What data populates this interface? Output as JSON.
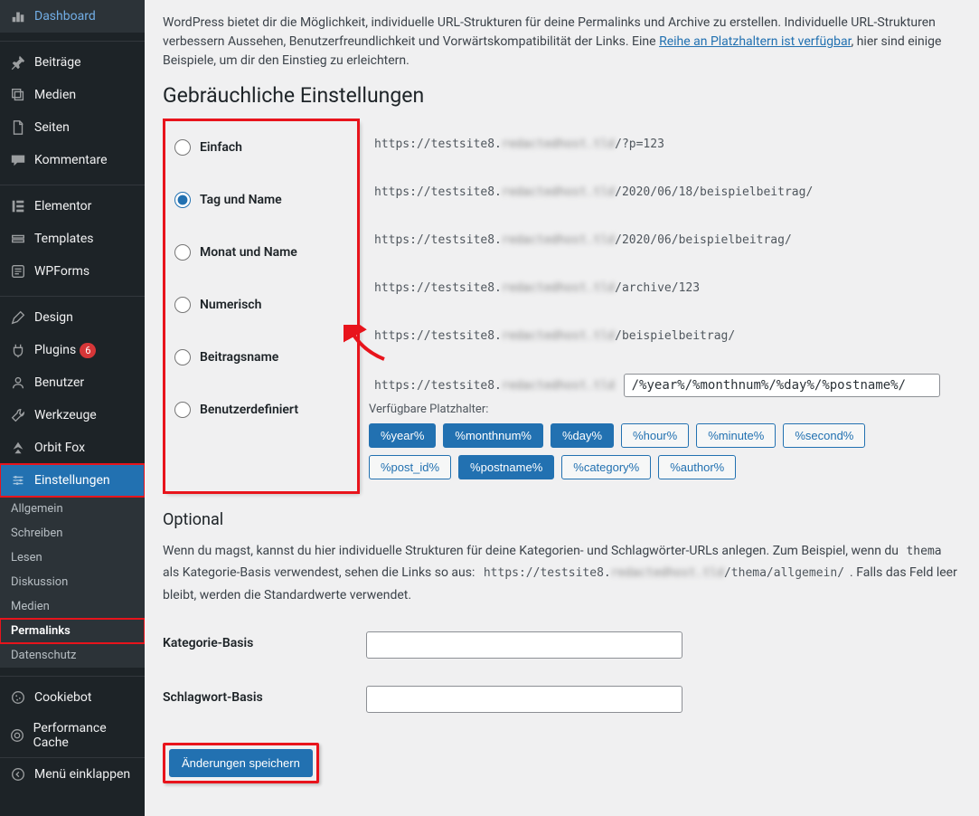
{
  "sidebar": {
    "dashboard": "Dashboard",
    "posts": "Beiträge",
    "media": "Medien",
    "pages": "Seiten",
    "comments": "Kommentare",
    "elementor": "Elementor",
    "templates": "Templates",
    "wpforms": "WPForms",
    "design": "Design",
    "plugins": "Plugins",
    "plugins_badge": "6",
    "users": "Benutzer",
    "tools": "Werkzeuge",
    "orbitfox": "Orbit Fox",
    "settings": "Einstellungen",
    "settings_sub": {
      "general": "Allgemein",
      "writing": "Schreiben",
      "reading": "Lesen",
      "discussion": "Diskussion",
      "media": "Medien",
      "permalinks": "Permalinks",
      "privacy": "Datenschutz"
    },
    "cookiebot": "Cookiebot",
    "perfcache": "Performance Cache",
    "collapse": "Menü einklappen"
  },
  "content": {
    "intro_1": "WordPress bietet dir die Möglichkeit, individuelle URL-Strukturen für deine Permalinks und Archive zu erstellen. Individuelle URL-Strukturen verbessern Aussehen, Benutzerfreundlichkeit und Vorwärtskompatibilität der Links. Eine ",
    "intro_link": "Reihe an Platzhaltern ist verfügbar",
    "intro_2": ", hier sind einige Beispiele, um dir den Einstieg zu erleichtern.",
    "common_heading": "Gebräuchliche Einstellungen",
    "options": {
      "plain": {
        "label": "Einfach",
        "url_prefix": "https://testsite8.",
        "url_suffix": "/?p=123"
      },
      "dayname": {
        "label": "Tag und Name",
        "url_prefix": "https://testsite8.",
        "url_suffix": "/2020/06/18/beispielbeitrag/"
      },
      "monthname": {
        "label": "Monat und Name",
        "url_prefix": "https://testsite8.",
        "url_suffix": "/2020/06/beispielbeitrag/"
      },
      "numeric": {
        "label": "Numerisch",
        "url_prefix": "https://testsite8.",
        "url_suffix": "/archive/123"
      },
      "postname": {
        "label": "Beitragsname",
        "url_prefix": "https://testsite8.",
        "url_suffix": "/beispielbeitrag/"
      },
      "custom": {
        "label": "Benutzerdefiniert",
        "url_prefix": "https://testsite8.",
        "value": "/%year%/%monthnum%/%day%/%postname%/"
      }
    },
    "available_label": "Verfügbare Platzhalter:",
    "tags": [
      "%year%",
      "%monthnum%",
      "%day%",
      "%hour%",
      "%minute%",
      "%second%",
      "%post_id%",
      "%postname%",
      "%category%",
      "%author%"
    ],
    "active_tags": [
      "%year%",
      "%monthnum%",
      "%day%",
      "%postname%"
    ],
    "optional_heading": "Optional",
    "optional_p1_a": "Wenn du magst, kannst du hier individuelle Strukturen für deine Kategorien- und Schlagwörter-URLs anlegen. Zum Beispiel, wenn du ",
    "optional_p1_code": "thema",
    "optional_p1_b": " als Kategorie-Basis verwendest, sehen die Links so aus: ",
    "optional_example_pre": "https://testsite8.",
    "optional_example_suf": "/thema/allgemein/",
    "optional_p1_c": ". Falls das Feld leer bleibt, werden die Standardwerte verwendet.",
    "category_base": "Kategorie-Basis",
    "tag_base": "Schlagwort-Basis",
    "save": "Änderungen speichern"
  }
}
